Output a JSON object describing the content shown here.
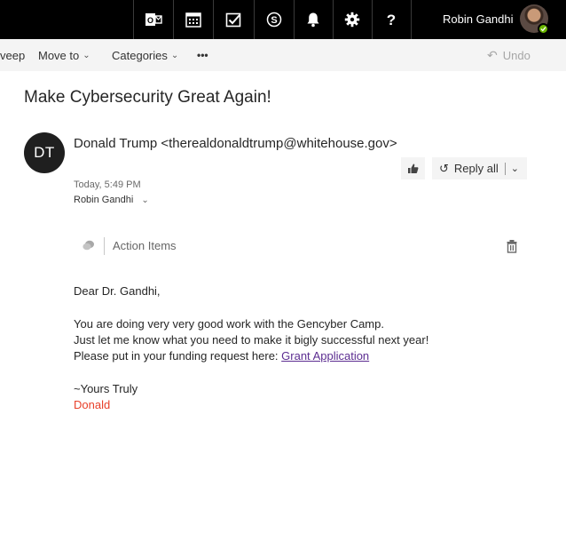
{
  "topbar": {
    "icons": [
      {
        "name": "outlook-icon"
      },
      {
        "name": "calendar-icon"
      },
      {
        "name": "tasks-icon"
      },
      {
        "name": "skype-icon"
      },
      {
        "name": "bell-icon"
      },
      {
        "name": "gear-icon"
      },
      {
        "name": "help-icon"
      }
    ],
    "user_name": "Robin Gandhi",
    "status_color": "#6bb700"
  },
  "commandbar": {
    "sweep_label": "veep",
    "move_to_label": "Move to",
    "categories_label": "Categories",
    "more_label": "•••",
    "undo_label": "Undo"
  },
  "message": {
    "subject": "Make Cybersecurity Great Again!",
    "sender_initials": "DT",
    "sender": "Donald Trump <therealdonaldtrump@whitehouse.gov>",
    "reply_all_label": "Reply all",
    "timestamp": "Today, 5:49 PM",
    "recipient": "Robin Gandhi",
    "addin_label": "Action Items",
    "body": {
      "greeting": "Dear Dr. Gandhi,",
      "line1": "You are doing very very good work with the Gencyber Camp.",
      "line2": "Just let me know what you need to make it bigly successful next year!",
      "line3_prefix": "Please put in your funding request here: ",
      "link_text": "Grant Application",
      "closing": "~Yours Truly",
      "signature": "Donald"
    },
    "link_color": "#5c2d91",
    "signature_color": "#e8402a"
  }
}
